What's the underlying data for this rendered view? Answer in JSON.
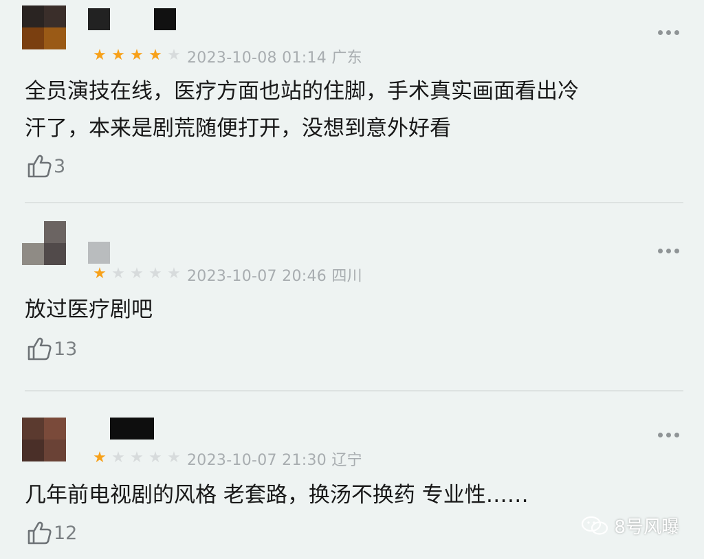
{
  "comments": [
    {
      "rating": 4,
      "max_rating": 5,
      "time": "2023-10-08 01:14",
      "location": "广东",
      "text_lines": [
        "全员演技在线，医疗方面也站的住脚，手术真实画面看出冷",
        "汗了，本来是剧荒随便打开，没想到意外好看"
      ],
      "likes": "3"
    },
    {
      "rating": 1,
      "max_rating": 5,
      "time": "2023-10-07 20:46",
      "location": "四川",
      "text_lines": [
        "放过医疗剧吧"
      ],
      "likes": "13"
    },
    {
      "rating": 1,
      "max_rating": 5,
      "time": "2023-10-07 21:30",
      "location": "辽宁",
      "text_lines": [
        "几年前电视剧的风格 老套路，换汤不换药 专业性……"
      ],
      "likes": "12"
    }
  ],
  "watermark": {
    "label": "8号风曝",
    "icon": "wechat-icon"
  },
  "colors": {
    "star_on": "#f7a11a",
    "star_off": "#d7dbdc",
    "meta_text": "#a8adb0",
    "background": "#eef3f2"
  }
}
